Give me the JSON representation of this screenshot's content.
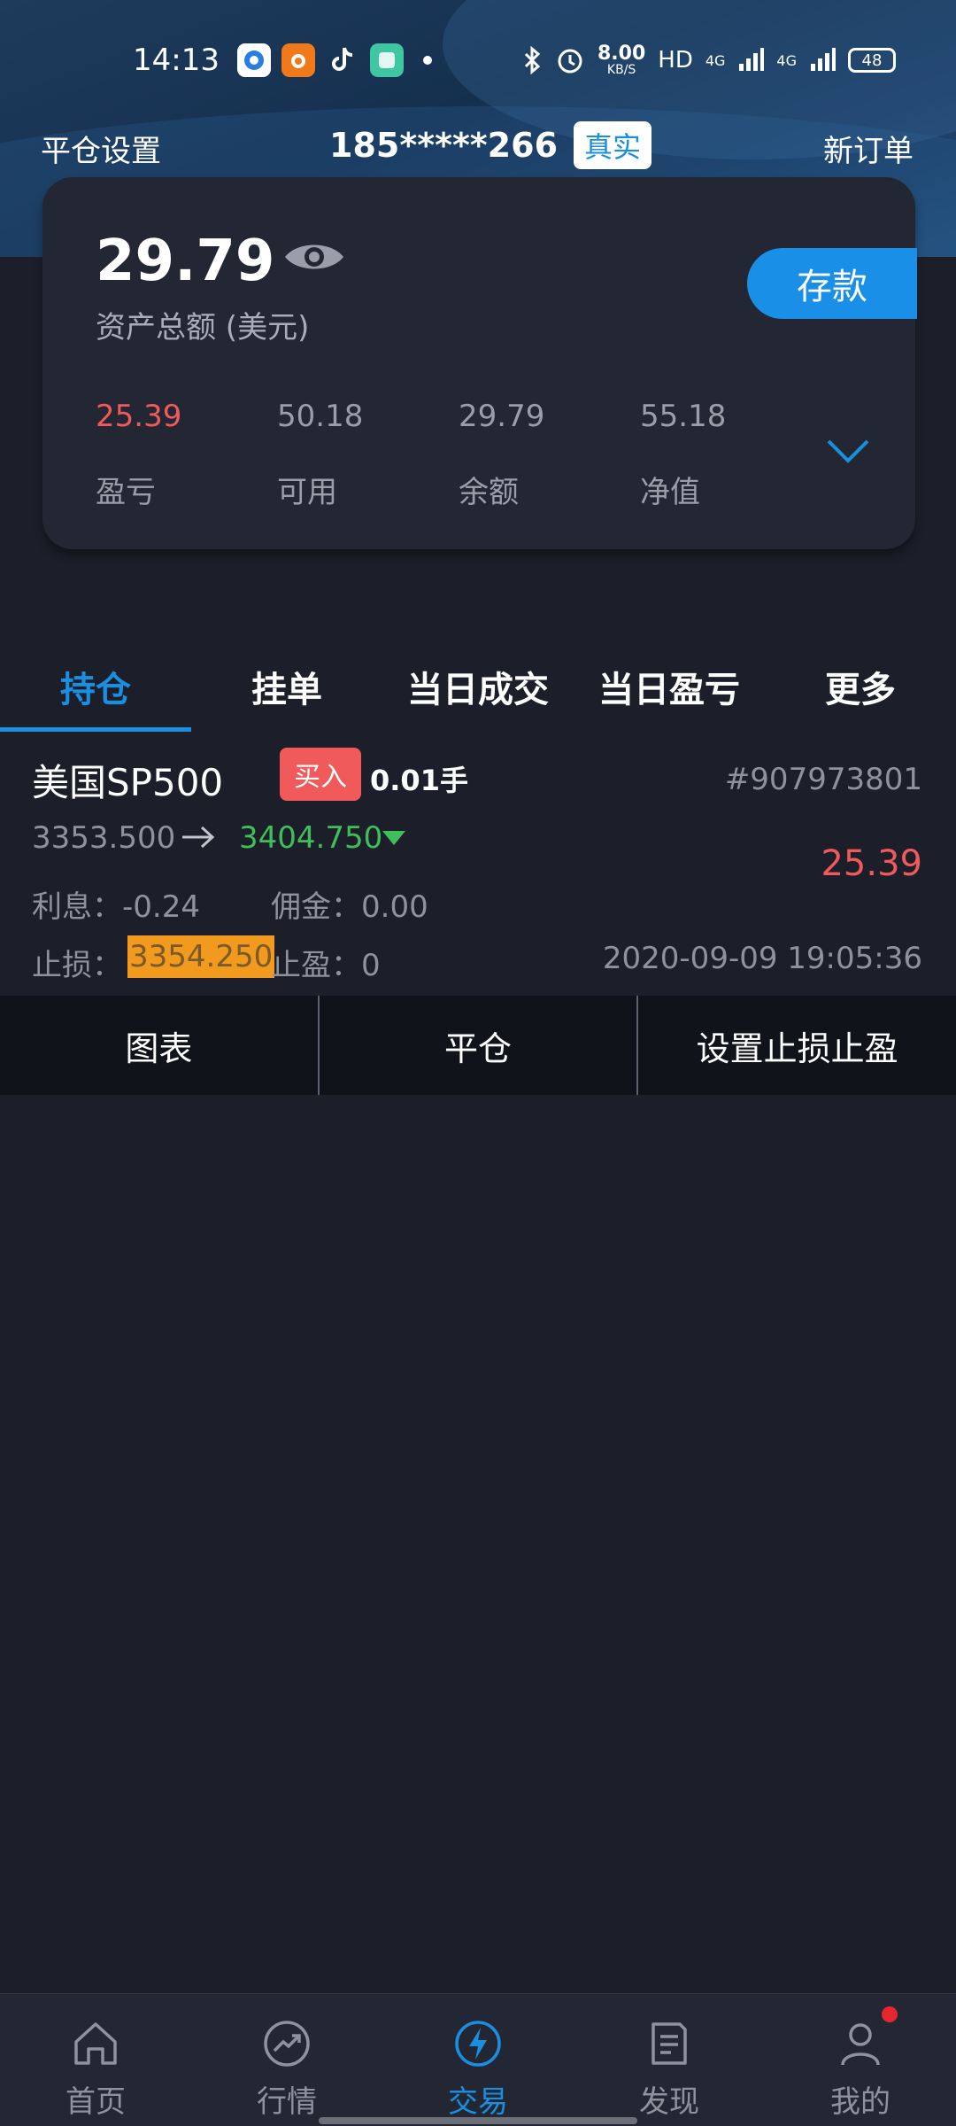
{
  "status_bar": {
    "time": "14:13",
    "net_speed_value": "8.00",
    "net_speed_unit": "KB/S",
    "hd_label": "HD",
    "signal1": "4G",
    "signal2": "4G",
    "battery": "48"
  },
  "top_nav": {
    "left_label": "平仓设置",
    "account": "185*****266",
    "account_type": "真实",
    "right_label": "新订单"
  },
  "assets": {
    "total": "29.79",
    "total_label": "资产总额 (美元)",
    "deposit_label": "存款",
    "stats": [
      {
        "value": "25.39",
        "label": "盈亏"
      },
      {
        "value": "50.18",
        "label": "可用"
      },
      {
        "value": "29.79",
        "label": "余额"
      },
      {
        "value": "55.18",
        "label": "净值"
      }
    ]
  },
  "tabs": [
    {
      "label": "持仓",
      "active": true
    },
    {
      "label": "挂单"
    },
    {
      "label": "当日成交"
    },
    {
      "label": "当日盈亏"
    },
    {
      "label": "更多"
    }
  ],
  "position": {
    "symbol": "美国SP500",
    "side": "买入",
    "lots": "0.01手",
    "order_no": "#907973801",
    "open_price": "3353.500",
    "current_price": "3404.750",
    "pnl": "25.39",
    "interest": "利息：-0.24",
    "commission": "佣金：0.00",
    "stop_loss_label": "止损：",
    "stop_loss_value": "3354.250",
    "take_profit": "止盈：0",
    "open_time": "2020-09-09 19:05:36"
  },
  "actions": [
    "图表",
    "平仓",
    "设置止损止盈"
  ],
  "bottom_nav": [
    {
      "label": "首页",
      "icon": "home-icon"
    },
    {
      "label": "行情",
      "icon": "market-icon"
    },
    {
      "label": "交易",
      "icon": "trade-icon",
      "active": true
    },
    {
      "label": "发现",
      "icon": "discover-icon"
    },
    {
      "label": "我的",
      "icon": "profile-icon",
      "badge": true
    }
  ],
  "colors": {
    "accent": "#1a8fe0",
    "profit": "#f05a5a",
    "price_down": "#3fbf5a",
    "highlight": "#f29a1e"
  }
}
